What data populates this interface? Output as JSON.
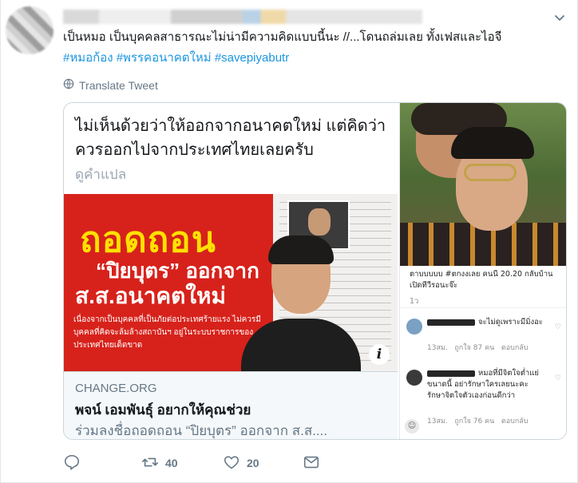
{
  "tweet": {
    "author_name": "",
    "text": "เป็นหมอ เป็นบุคคลสาธารณะไม่น่ามีความคิดแบบนี้นะ //...โดนถล่มเลย ทั้งเฟสและไอจี",
    "hashtags": "#หมอก้อง #พรรคอนาคตใหม่ #savepiyabutr",
    "translate_label": "Translate Tweet",
    "icons": {
      "menu": "chevron-down-icon",
      "translate": "globe-icon"
    }
  },
  "card": {
    "quote_text": "ไม่เห็นด้วยว่าให้ออกจากอนาคตใหม่ แต่คิดว่าควรออกไปจากประเทศไทยเลยครับ",
    "quote_translate": "ดูคำแปล",
    "banner": {
      "title1": "ถอดถอน",
      "title2": "“ปิยบุตร” ออกจาก",
      "title3": "ส.ส.อนาคตใหม่",
      "sub": "เนื่องจากเป็นบุคคลที่เป็นภัยต่อประเทศร้ายแรง ไม่ควรมีบุคคลที่คิดจะล้มล้างสถาบันฯ อยู่ในระบบราชการของประเทศไทยเด็ดขาด",
      "info_label": "i"
    },
    "link": {
      "domain": "CHANGE.ORG",
      "title": "พจน์ เอมพันธุ์ อยากให้คุณช่วย",
      "description": "ร่วมลงชื่อถอดถอน “ปิยบุตร” ออกจาก ส.ส...."
    },
    "instagram": {
      "top_caption": "ตาบบบบบ #ตกงงเลย คนนี 20.20 กลับบ้านเปิดทีวีรอนะจ๊ะ",
      "top_time": "1ว",
      "comments": [
        {
          "text": "จะไม่ดูเพราะมีมิ่งอะ",
          "time": "13สม.",
          "likes": "ถูกใจ 87 คน",
          "reply": "ตอบกลับ"
        },
        {
          "text": "หมอที่มีจิตใจต่ำแย่ขนาดนี้ อย่ารักษาใครเลยนะคะ รักษาจิตใจตัวเองก่อนดีกว่า",
          "time": "13สม.",
          "likes": "ถูกใจ 76 คน",
          "reply": "ตอบกลับ"
        }
      ]
    }
  },
  "actions": {
    "reply_count": "",
    "retweet_count": "40",
    "like_count": "20",
    "icons": [
      "reply-icon",
      "retweet-icon",
      "like-icon",
      "message-icon"
    ]
  },
  "colors": {
    "link_blue": "#1b95e0",
    "muted": "#657786",
    "banner_red": "#d7221b",
    "banner_yellow": "#ffe100"
  }
}
